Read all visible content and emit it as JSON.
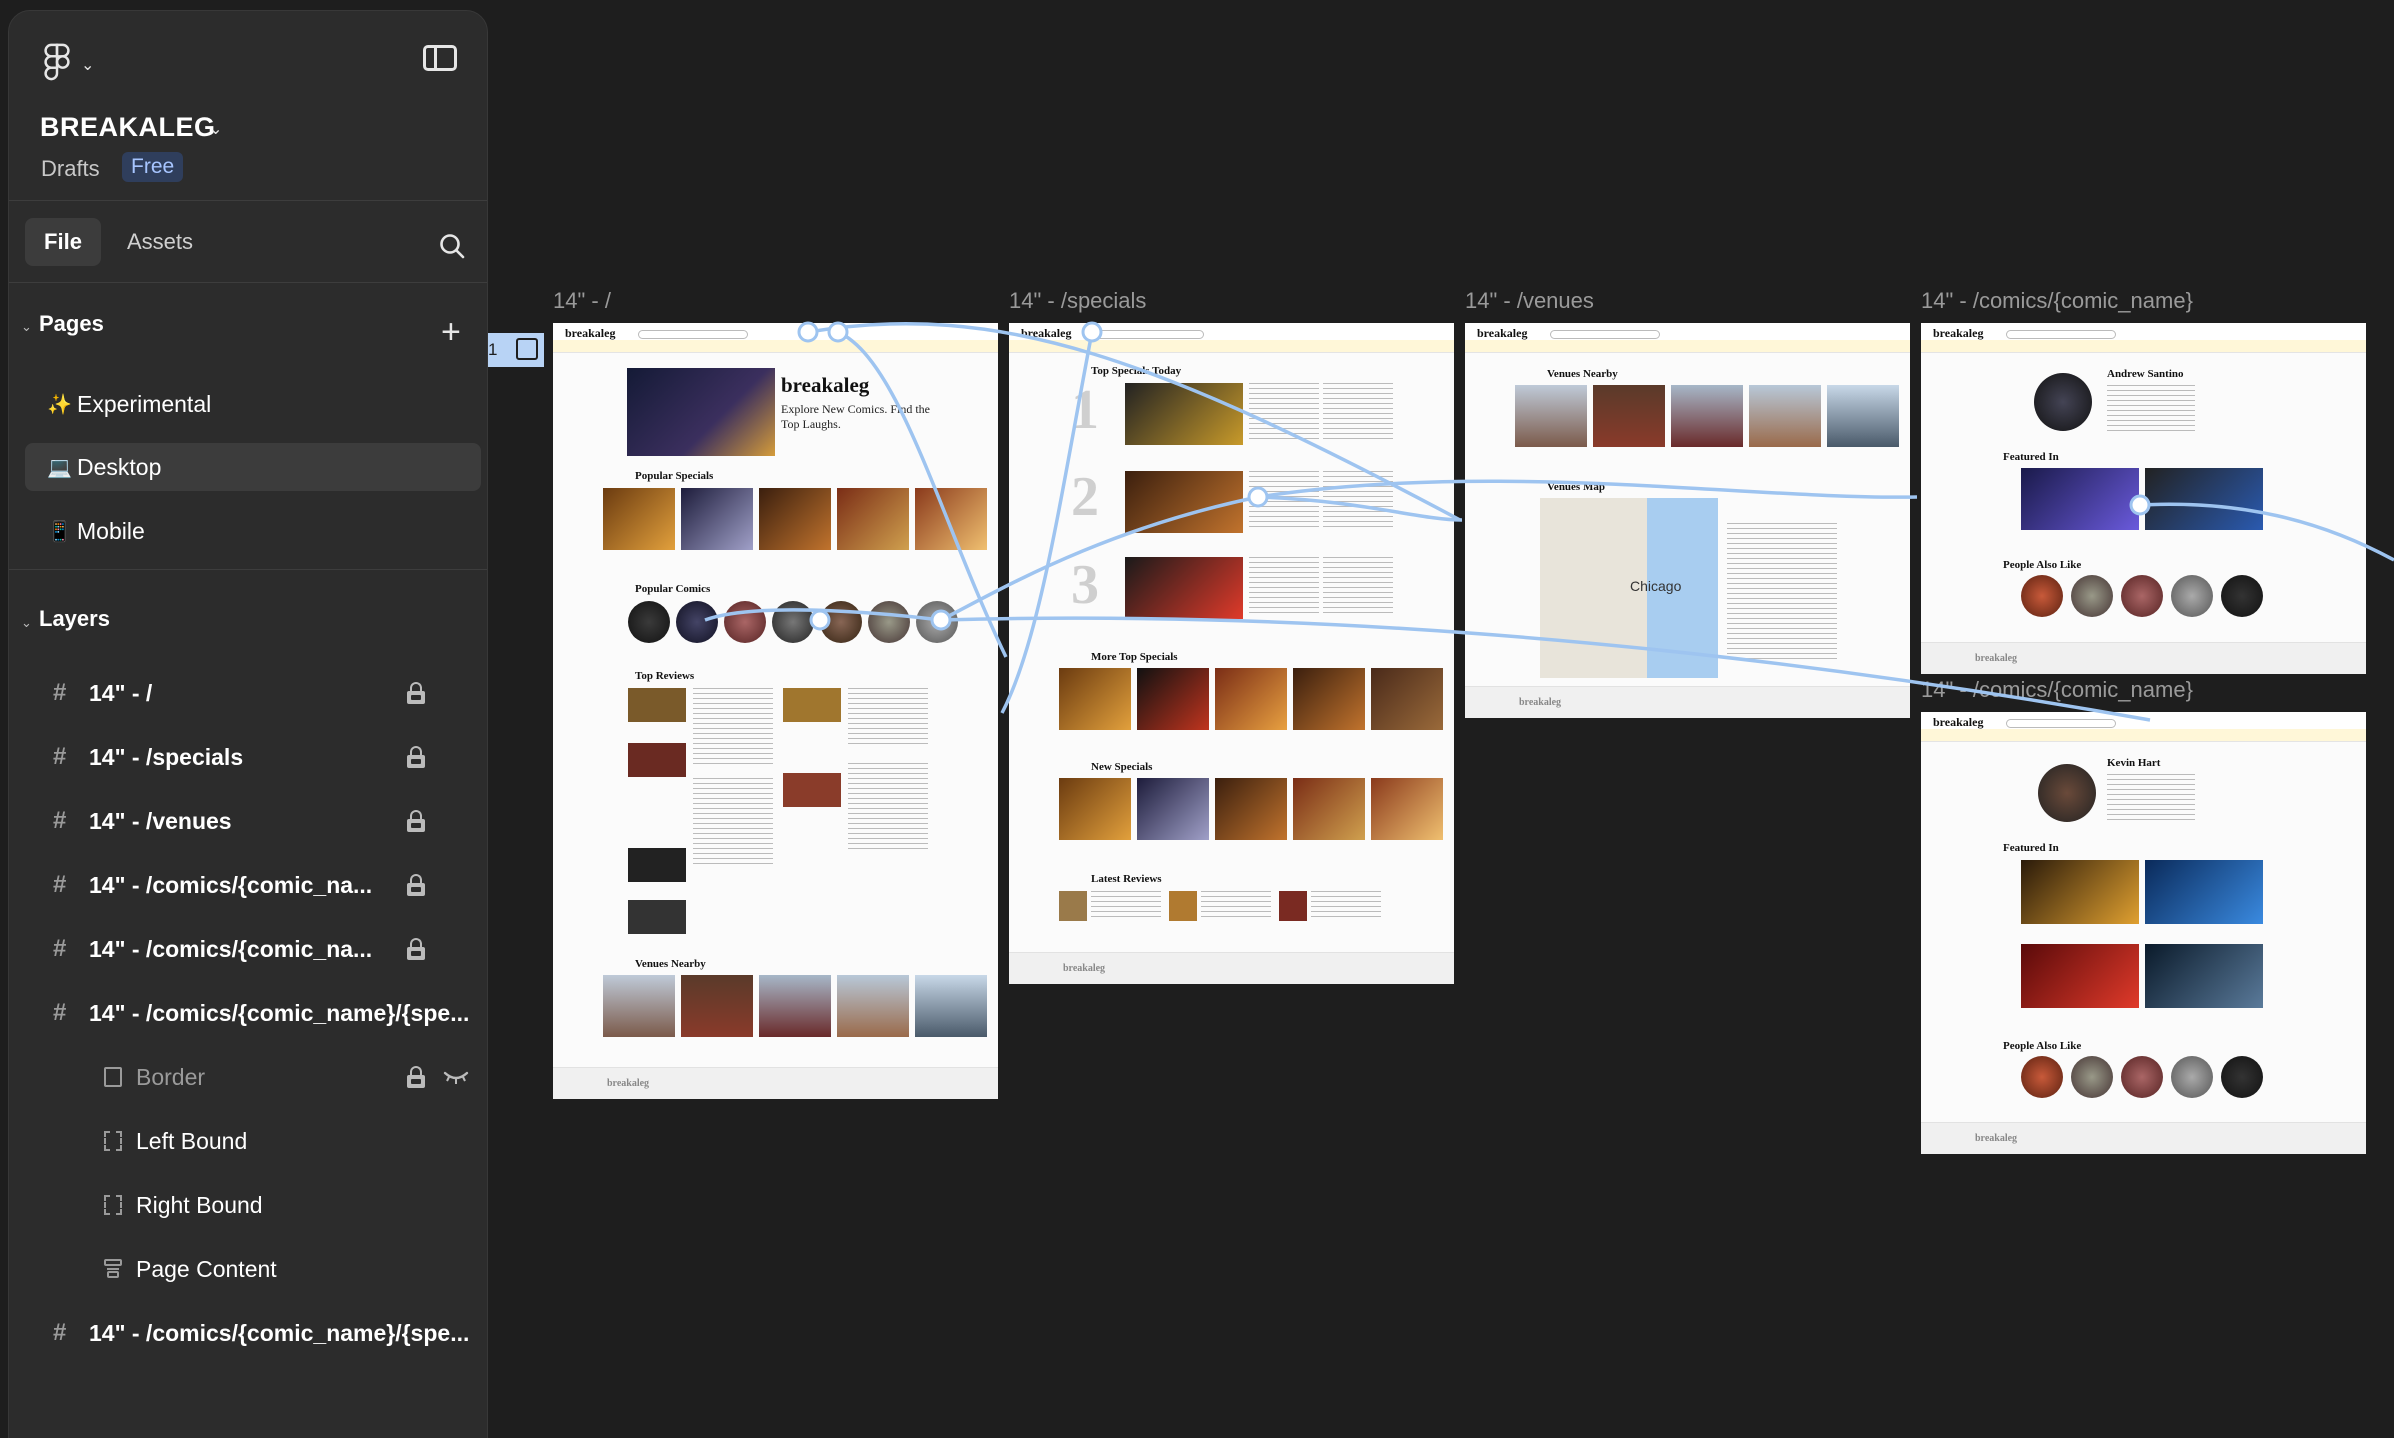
{
  "sidebar": {
    "project_name": "BREAKALEG",
    "location": "Drafts",
    "plan_badge": "Free",
    "tabs": {
      "file": "File",
      "assets": "Assets"
    },
    "pages_title": "Pages",
    "pages": [
      {
        "emoji": "✨",
        "label": "Experimental"
      },
      {
        "emoji": "💻",
        "label": "Desktop"
      },
      {
        "emoji": "📱",
        "label": "Mobile"
      }
    ],
    "layers_title": "Layers",
    "layers": [
      {
        "label": "14\" - /"
      },
      {
        "label": "14\" - /specials"
      },
      {
        "label": "14\" - /venues"
      },
      {
        "label": "14\" - /comics/{comic_na..."
      },
      {
        "label": "14\" - /comics/{comic_na..."
      },
      {
        "label": "14\" - /comics/{comic_name}/{spe..."
      },
      {
        "label": "Border"
      },
      {
        "label": "Left Bound"
      },
      {
        "label": "Right Bound"
      },
      {
        "label": "Page Content"
      },
      {
        "label": "14\" - /comics/{comic_name}/{spe..."
      }
    ]
  },
  "canvas": {
    "badge_number": "1",
    "frames": {
      "home": {
        "label": "14\" - /",
        "logo": "breakaleg",
        "hero": "Explore New Comics. Find the Top Laughs.",
        "hero_logo": "breakaleg",
        "popular_specials": "Popular Specials",
        "popular_comics": "Popular Comics",
        "top_reviews": "Top Reviews",
        "venues_nearby": "Venues Nearby",
        "footer": "breakaleg"
      },
      "specials": {
        "label": "14\" - /specials",
        "logo": "breakaleg",
        "top_specials_today": "Top Specials Today",
        "ranks": [
          "1",
          "2",
          "3"
        ],
        "more_top_specials": "More Top Specials",
        "new_specials": "New Specials",
        "latest_reviews": "Latest Reviews",
        "footer": "breakaleg"
      },
      "venues": {
        "label": "14\" - /venues",
        "logo": "breakaleg",
        "venues_nearby": "Venues Nearby",
        "venues_map": "Venues Map",
        "map_city": "Chicago",
        "footer": "breakaleg"
      },
      "comic1": {
        "label": "14\" - /comics/{comic_name}",
        "logo": "breakaleg",
        "name": "Andrew Santino",
        "featured_in": "Featured In",
        "people_also_like": "People Also Like",
        "footer": "breakaleg"
      },
      "comic2": {
        "label": "14\" - /comics/{comic_name}",
        "logo": "breakaleg",
        "name": "Kevin Hart",
        "featured_in": "Featured In",
        "people_also_like": "People Also Like",
        "footer": "breakaleg"
      }
    }
  },
  "colors": {
    "accent": "#a7c5ff",
    "prototype_link": "#9ec4f0"
  }
}
